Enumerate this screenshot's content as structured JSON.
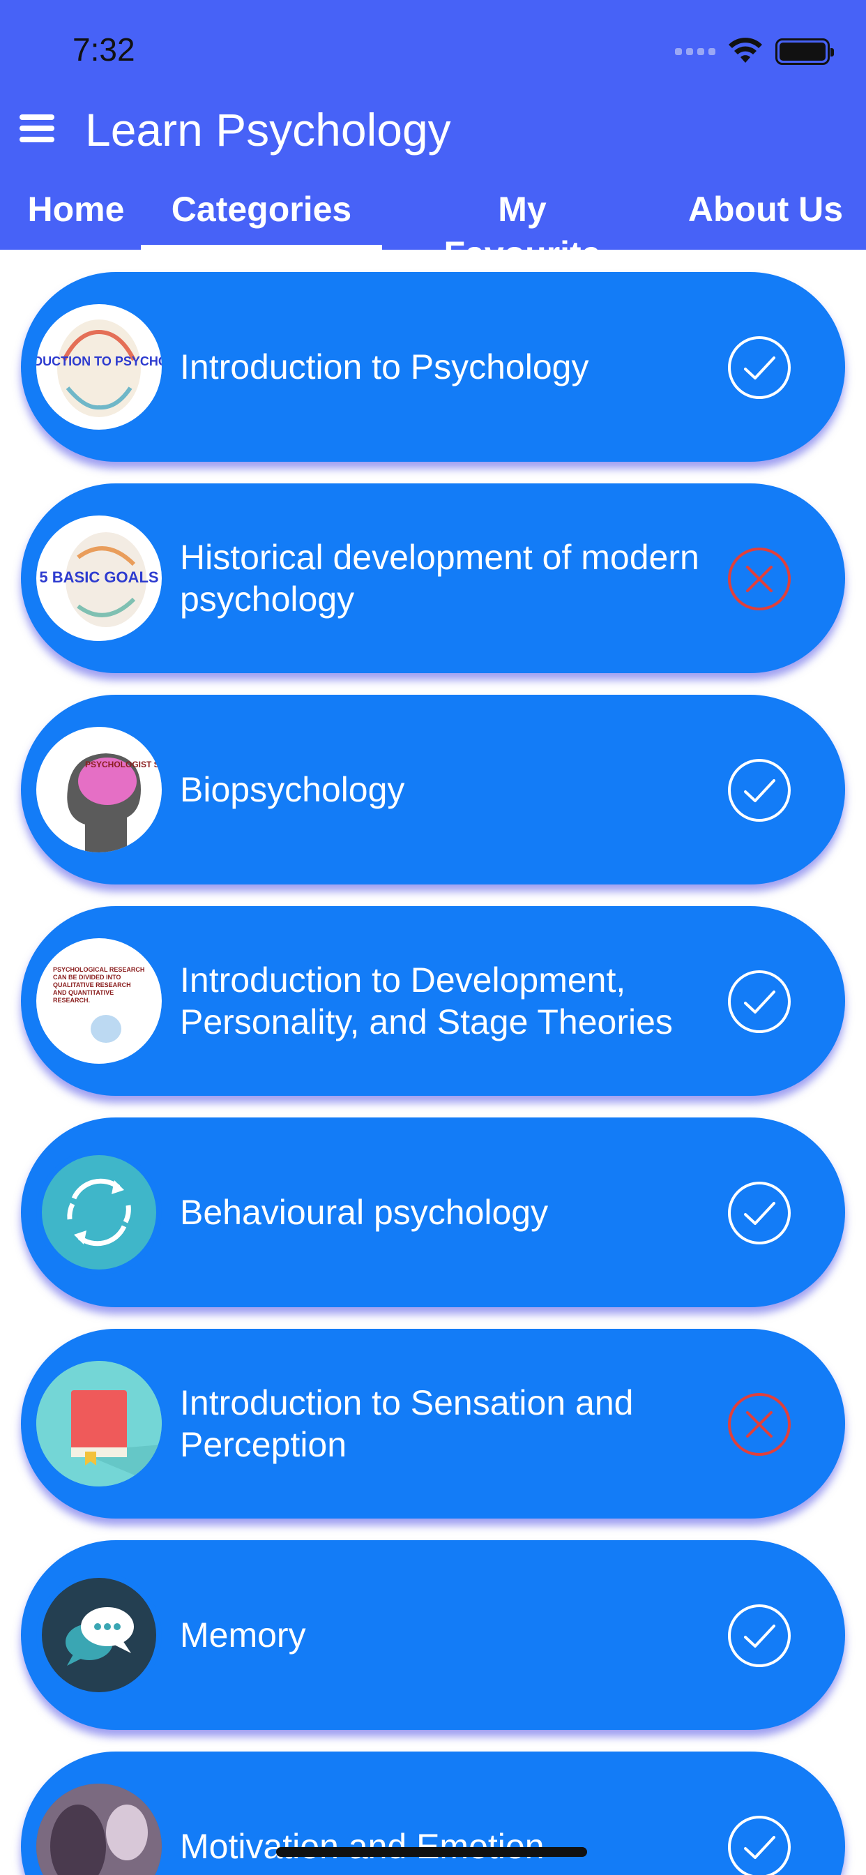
{
  "status_bar": {
    "time": "7:32"
  },
  "app": {
    "title": "Learn Psychology"
  },
  "tabs": [
    {
      "label": "Home",
      "active": false
    },
    {
      "label": "Categories",
      "active": true
    },
    {
      "label": "My Favourite",
      "active": false
    },
    {
      "label": "About Us",
      "active": false
    }
  ],
  "categories": [
    {
      "title": "Introduction to Psychology",
      "status": "check-circle-icon",
      "thumb_text": "INTRODUCTION TO PSYCHOLOGY"
    },
    {
      "title": "Historical development of modern psychology",
      "status": "x-circle-icon",
      "thumb_text": "5 BASIC GOALS"
    },
    {
      "title": "Biopsychology",
      "status": "check-circle-icon",
      "thumb_text": "PSYCHOLOGIST SAYS"
    },
    {
      "title": "Introduction to Development, Personality, and Stage Theories",
      "status": "check-circle-icon",
      "thumb_text": "PSYCHOLOGICAL RESEARCH CAN BE DIVIDED INTO QUALITATIVE RESEARCH AND QUANTITATIVE RESEARCH."
    },
    {
      "title": "Behavioural psychology",
      "status": "check-circle-icon"
    },
    {
      "title": "Introduction to Sensation and Perception",
      "status": "x-circle-icon"
    },
    {
      "title": "Memory",
      "status": "check-circle-icon"
    },
    {
      "title": "Motivation and Emotion",
      "status": "check-circle-icon"
    }
  ],
  "colors": {
    "header": "#4762f7",
    "card": "#137cf7",
    "check": "#ffffff",
    "cross": "#e0403b"
  }
}
